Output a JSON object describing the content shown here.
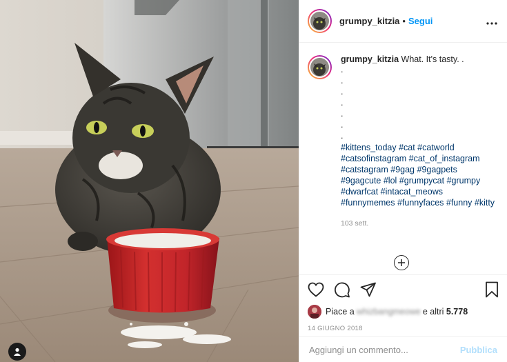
{
  "post": {
    "username": "grumpy_kitzia",
    "follow_label": "Segui",
    "separator": "•",
    "more_label": "•••"
  },
  "caption": {
    "username": "grumpy_kitzia",
    "text": "What. It's tasty. .",
    "dots": [
      ".",
      ".",
      ".",
      ".",
      ".",
      ".",
      "."
    ],
    "hashtags": "#kittens_today #cat #catworld #catsofinstagram #cat_of_instagram #catstagram #9gag #9gagpets #9gagcute #lol #grumpycat #grumpy #dwarfcat #intacat_meows #funnymemes #funnyfaces #funny #kitty",
    "time": "103 sett."
  },
  "add_comment_icon": "plus-circle-icon",
  "likes": {
    "prefix": "Piace a",
    "blurred_user": "whizbangmeowe",
    "suffix": "e altri",
    "count": "5.778"
  },
  "date": "14 GIUGNO 2018",
  "comment": {
    "placeholder": "Aggiungi un commento...",
    "post_label": "Pubblica"
  },
  "icons": [
    "heart-icon",
    "comment-icon",
    "share-icon",
    "bookmark-icon",
    "user-tag-icon",
    "more-icon"
  ],
  "colors": {
    "link": "#0095f6",
    "hashtag": "#00376b",
    "muted": "#8e8e8e",
    "bowl": "#c8262b"
  }
}
